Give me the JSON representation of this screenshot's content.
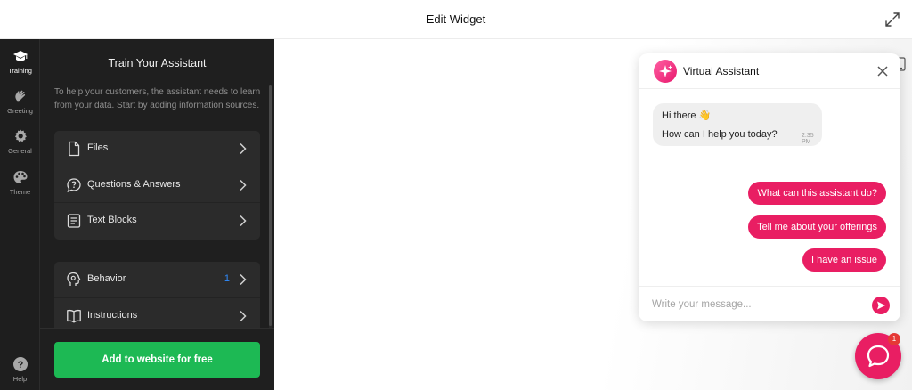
{
  "header": {
    "title": "Edit Widget"
  },
  "rail": {
    "items": [
      {
        "label": "Training",
        "icon": "graduation-cap-icon",
        "active": true
      },
      {
        "label": "Greeting",
        "icon": "waving-hand-icon",
        "active": false
      },
      {
        "label": "General",
        "icon": "gear-icon",
        "active": false
      },
      {
        "label": "Theme",
        "icon": "palette-icon",
        "active": false
      }
    ],
    "help": {
      "label": "Help",
      "icon": "question-circle-icon"
    }
  },
  "panel": {
    "title": "Train Your Assistant",
    "description": "To help your customers, the assistant needs to learn from your data. Start by adding information sources.",
    "sources": [
      {
        "label": "Files",
        "icon": "file-icon"
      },
      {
        "label": "Questions & Answers",
        "icon": "question-bubble-icon"
      },
      {
        "label": "Text Blocks",
        "icon": "text-block-icon"
      }
    ],
    "settings": [
      {
        "label": "Behavior",
        "icon": "head-gear-icon",
        "count": "1"
      },
      {
        "label": "Instructions",
        "icon": "book-icon",
        "count": ""
      }
    ],
    "cta_label": "Add to website for free"
  },
  "chat": {
    "name": "Virtual Assistant",
    "greeting_line1": "Hi there 👋",
    "greeting_line2": "How can I help you today?",
    "time": "2:35 PM",
    "quick_replies": [
      "What can this assistant do?",
      "Tell me about your offerings",
      "I have an issue"
    ],
    "composer_placeholder": "Write your message...",
    "launcher_badge": "1"
  },
  "colors": {
    "accent": "#e91e63",
    "cta": "#1db954",
    "panel_bg": "#1f1f1f",
    "count_blue": "#2f8cff"
  }
}
